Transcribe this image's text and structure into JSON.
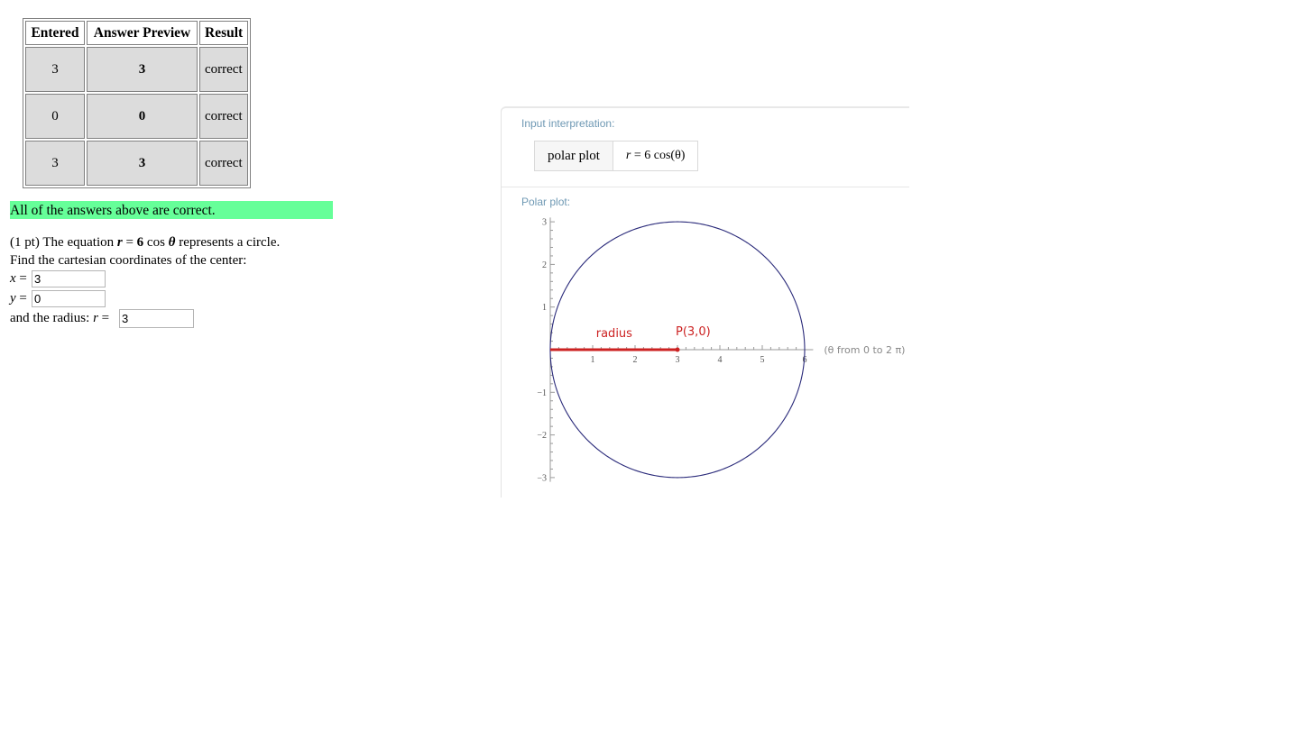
{
  "table": {
    "headers": [
      "Entered",
      "Answer Preview",
      "Result"
    ],
    "rows": [
      {
        "entered": "3",
        "preview": "3",
        "result": "correct"
      },
      {
        "entered": "0",
        "preview": "0",
        "result": "correct"
      },
      {
        "entered": "3",
        "preview": "3",
        "result": "correct"
      }
    ]
  },
  "message": "All of the answers above are correct.",
  "problem": {
    "points": "(1 pt) The equation",
    "eq_r": "r",
    "eq_equals": " = ",
    "eq_six": "6",
    "eq_cos": " cos ",
    "eq_theta": "θ",
    "eq_tail": " represents a circle.",
    "line2": "Find the cartesian coordinates of the center:",
    "x_var": "x",
    "y_var": "y",
    "eq_sign": " =",
    "radius_prefix": "and the radius: ",
    "r_var": "r",
    "x_value": "3",
    "y_value": "0",
    "r_value": "3"
  },
  "wolfram": {
    "interp_label": "Input interpretation:",
    "interp_left": "polar plot",
    "interp_r": "r",
    "interp_right": " = 6 cos(θ)",
    "plot_label": "Polar plot:",
    "range_note": "(θ from 0 to 2 π)",
    "radius_annotation": "radius",
    "point_annotation": "P(3,0)"
  },
  "chart_data": {
    "type": "line",
    "title": "",
    "equation": "r = 6 cos(θ)",
    "parameter_range": [
      0,
      6.283
    ],
    "x_ticks": [
      "1",
      "2",
      "3",
      "4",
      "5",
      "6"
    ],
    "y_ticks": [
      "3",
      "2",
      "1",
      "−1",
      "−2",
      "−3"
    ],
    "xlim": [
      0,
      6
    ],
    "ylim": [
      -3,
      3
    ],
    "circle_center": [
      3,
      0
    ],
    "circle_radius": 3,
    "point": {
      "label": "P(3,0)",
      "x": 3,
      "y": 0
    },
    "radius_segment": {
      "label": "radius",
      "from": [
        0,
        0
      ],
      "to": [
        3,
        0
      ]
    },
    "colors": {
      "curve": "#2a2a7a",
      "annotation": "#cc2222",
      "axis": "#999999"
    },
    "grid": false
  }
}
